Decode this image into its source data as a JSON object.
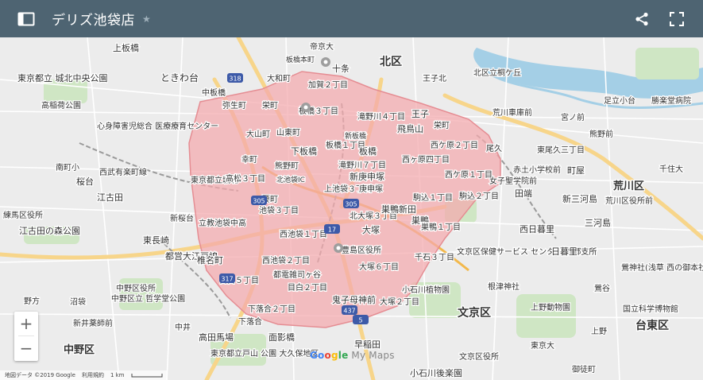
{
  "header": {
    "title": "デリズ池袋店",
    "bg_color": "#4e6472"
  },
  "map": {
    "zone_color": "#f4a9ad",
    "labels": [
      {
        "text": "北区"
      },
      {
        "text": "帝京大"
      },
      {
        "text": "板橋本町"
      },
      {
        "text": "十条"
      },
      {
        "text": "上板橋"
      },
      {
        "text": "東京都立 城北中央公園"
      },
      {
        "text": "ときわ台"
      },
      {
        "text": "大和町"
      },
      {
        "text": "加賀２丁目"
      },
      {
        "text": "王子北"
      },
      {
        "text": "北区立桐ケ丘"
      },
      {
        "text": "高稲荷公園"
      },
      {
        "text": "中板橋"
      },
      {
        "text": "弥生町"
      },
      {
        "text": "栄町"
      },
      {
        "text": "板橋３丁目"
      },
      {
        "text": "滝野川４丁目"
      },
      {
        "text": "王子"
      },
      {
        "text": "荒川車庫前"
      },
      {
        "text": "足立小台"
      },
      {
        "text": "勝楽堂病院"
      },
      {
        "text": "心身障害児総合 医療療育センター"
      },
      {
        "text": "大山町"
      },
      {
        "text": "山東町"
      },
      {
        "text": "飛鳥山"
      },
      {
        "text": "栄町"
      },
      {
        "text": "宮ノ前"
      },
      {
        "text": "熊野前"
      },
      {
        "text": "新板橋"
      },
      {
        "text": "板橋１丁目"
      },
      {
        "text": "西ケ原２丁目"
      },
      {
        "text": "尾久"
      },
      {
        "text": "東尾久三丁目"
      },
      {
        "text": "幸町"
      },
      {
        "text": "下板橋"
      },
      {
        "text": "板橋"
      },
      {
        "text": "西ヶ原四丁目"
      },
      {
        "text": "南町小"
      },
      {
        "text": "西武有楽町線"
      },
      {
        "text": "熊野町"
      },
      {
        "text": "滝野川７丁目"
      },
      {
        "text": "新庚申塚"
      },
      {
        "text": "西ケ原１丁目"
      },
      {
        "text": "赤土小学校前"
      },
      {
        "text": "町屋"
      },
      {
        "text": "千住大"
      },
      {
        "text": "桜台"
      },
      {
        "text": "東京都立城北"
      },
      {
        "text": "高松３丁目"
      },
      {
        "text": "北池袋IC"
      },
      {
        "text": "上池袋３丁目"
      },
      {
        "text": "庚申塚"
      },
      {
        "text": "女子聖学院前"
      },
      {
        "text": "田端"
      },
      {
        "text": "新三河島"
      },
      {
        "text": "荒川区"
      },
      {
        "text": "江古田"
      },
      {
        "text": "要町"
      },
      {
        "text": "池袋３丁目"
      },
      {
        "text": "駒込１丁目"
      },
      {
        "text": "駒込２丁目"
      },
      {
        "text": "荒川区役所前"
      },
      {
        "text": "練馬区役所"
      },
      {
        "text": "北大塚３丁目"
      },
      {
        "text": "巣鴨新田"
      },
      {
        "text": "巣鴨"
      },
      {
        "text": "三河島"
      },
      {
        "text": "江古田の森公園"
      },
      {
        "text": "新桜台"
      },
      {
        "text": "立教池袋中高"
      },
      {
        "text": "大塚"
      },
      {
        "text": "巣鴨１丁目"
      },
      {
        "text": "西日暮里"
      },
      {
        "text": "東長崎"
      },
      {
        "text": "西池袋１丁目"
      },
      {
        "text": "豊島区役所"
      },
      {
        "text": "文京区保健サービス センター 本郷支所"
      },
      {
        "text": "日暮里"
      },
      {
        "text": "都営大江戸線"
      },
      {
        "text": "椎名町"
      },
      {
        "text": "西池袋２丁目"
      },
      {
        "text": "大塚６丁目"
      },
      {
        "text": "千石３丁目"
      },
      {
        "text": "鶯神社(浅草 西の御本社)"
      },
      {
        "text": "中野区役所"
      },
      {
        "text": "都電雑司ヶ谷"
      },
      {
        "text": "根津神社"
      },
      {
        "text": "鶯谷"
      },
      {
        "text": "中野区立 哲学堂公園"
      },
      {
        "text": "目白５丁目"
      },
      {
        "text": "目白２丁目"
      },
      {
        "text": "小石川植物園"
      },
      {
        "text": "野方"
      },
      {
        "text": "沼袋"
      },
      {
        "text": "鬼子母神前"
      },
      {
        "text": "大塚２丁目"
      },
      {
        "text": "文京区"
      },
      {
        "text": "上野動物園"
      },
      {
        "text": "新井薬師前"
      },
      {
        "text": "下落合２丁目"
      },
      {
        "text": "国立科学博物館"
      },
      {
        "text": "台東区"
      },
      {
        "text": "中井"
      },
      {
        "text": "下落合"
      },
      {
        "text": "上野"
      },
      {
        "text": "中野区"
      },
      {
        "text": "高田馬場"
      },
      {
        "text": "面影橋"
      },
      {
        "text": "早稲田"
      },
      {
        "text": "東京大"
      },
      {
        "text": "東京都立戸山 公園 大久保地区"
      },
      {
        "text": "文京区役所"
      },
      {
        "text": "小石川後楽園"
      },
      {
        "text": "御徒町"
      }
    ],
    "route_numbers": [
      "318",
      "305",
      "305",
      "317",
      "437",
      "17",
      "5"
    ]
  },
  "controls": {
    "zoom_in": "+",
    "zoom_out": "−"
  },
  "footer": {
    "data": "地図データ ©2019 Google",
    "terms": "利用規約",
    "scale": "1 km"
  },
  "brand": {
    "g1": "Go",
    "g2": "o",
    "g3": "g",
    "g4": "le",
    "maps": "My Maps"
  },
  "icons": {
    "toggle": "sidebar-toggle-icon",
    "star": "star-icon",
    "share": "share-icon",
    "fullscreen": "fullscreen-icon"
  }
}
